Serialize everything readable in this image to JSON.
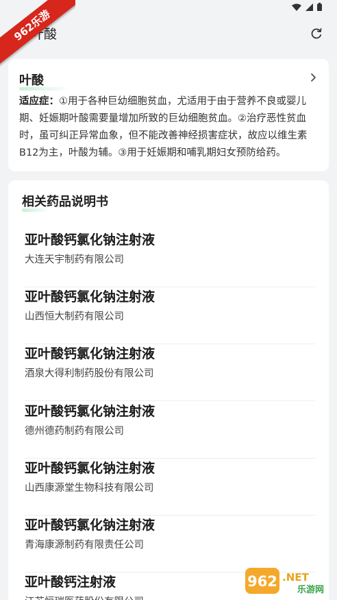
{
  "ribbon": {
    "text": "962乐游"
  },
  "header": {
    "title": "叶酸",
    "refresh_icon": "refresh-icon"
  },
  "drug_card": {
    "name": "叶酸",
    "indication_label": "适应症：",
    "indication_text": "①用于各种巨幼细胞贫血，尤适用于由于营养不良或婴儿期、妊娠期叶酸需要量增加所致的巨幼细胞贫血。②治疗恶性贫血时，虽可纠正异常血象，但不能改善神经损害症状，故应以维生素B12为主，叶酸为辅。③用于妊娠期和哺乳期妇女预防给药。"
  },
  "related": {
    "title": "相关药品说明书",
    "items": [
      {
        "name": "亚叶酸钙氯化钠注射液",
        "company": "大连天宇制药有限公司"
      },
      {
        "name": "亚叶酸钙氯化钠注射液",
        "company": "山西恒大制药有限公司"
      },
      {
        "name": "亚叶酸钙氯化钠注射液",
        "company": "酒泉大得利制药股份有限公司"
      },
      {
        "name": "亚叶酸钙氯化钠注射液",
        "company": "德州德药制药有限公司"
      },
      {
        "name": "亚叶酸钙氯化钠注射液",
        "company": "山西康源堂生物科技有限公司"
      },
      {
        "name": "亚叶酸钙氯化钠注射液",
        "company": "青海康源制药有限责任公司"
      },
      {
        "name": "亚叶酸钙注射液",
        "company": "江苏恒瑞医药股份有限公司"
      }
    ]
  },
  "watermark": {
    "brand": "962.NET",
    "sub": "乐游网"
  }
}
